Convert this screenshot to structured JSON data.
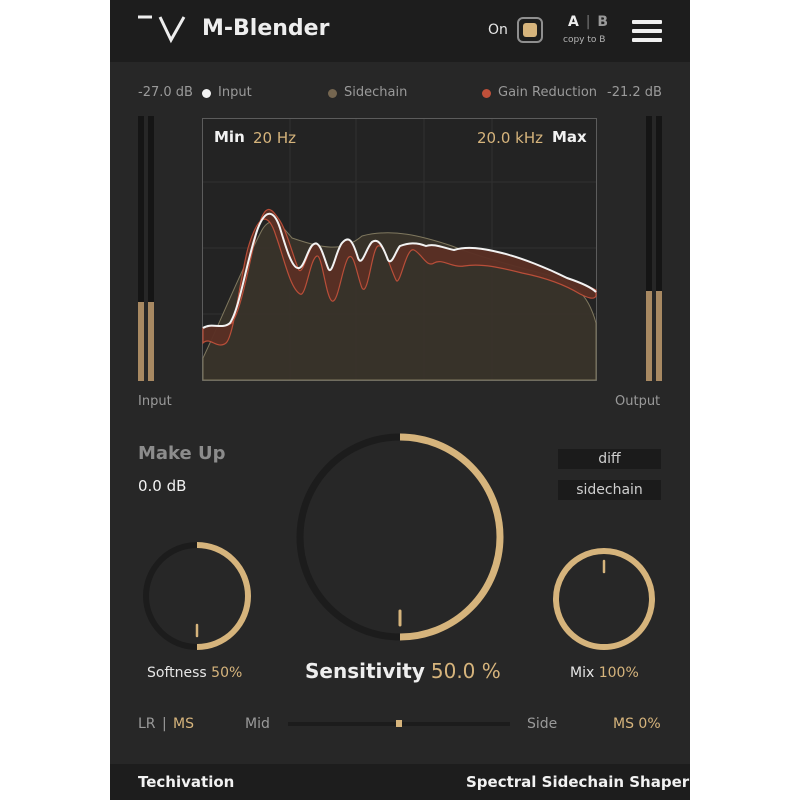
{
  "header": {
    "title": "M-Blender",
    "on_label": "On",
    "ab_a": "A",
    "ab_sep": "|",
    "ab_b": "B",
    "copy_label": "copy to B"
  },
  "legend": {
    "input_db": "-27.0 dB",
    "input_label": "Input",
    "sidechain_label": "Sidechain",
    "gain_reduction_label": "Gain Reduction",
    "output_db": "-21.2 dB"
  },
  "spectrum": {
    "min_label": "Min",
    "min_value": "20 Hz",
    "max_value": "20.0 kHz",
    "max_label": "Max"
  },
  "meters": {
    "input_label": "Input",
    "output_label": "Output",
    "input_level": 0.3,
    "output_level": 0.34
  },
  "makeup": {
    "title": "Make Up",
    "value": "0.0 dB"
  },
  "buttons": {
    "diff": "diff",
    "sidechain": "sidechain"
  },
  "knobs": {
    "softness_label": "Softness",
    "softness_value": "50%",
    "softness_level": 0.5,
    "sensitivity_label": "Sensitivity",
    "sensitivity_value": "50.0 %",
    "sensitivity_level": 0.5,
    "mix_label": "Mix",
    "mix_value": "100%",
    "mix_level": 1.0
  },
  "mode": {
    "lr": "LR",
    "sep": "|",
    "ms": "MS",
    "mid": "Mid",
    "side": "Side",
    "ms_value": "MS 0%",
    "mid_side_balance": 0.5
  },
  "footer": {
    "brand": "Techivation",
    "product": "Spectral Sidechain Shaper"
  },
  "colors": {
    "accent": "#d6b47c",
    "gain_reduction": "#c0503a",
    "panel": "#272727",
    "header": "#1d1d1d"
  }
}
